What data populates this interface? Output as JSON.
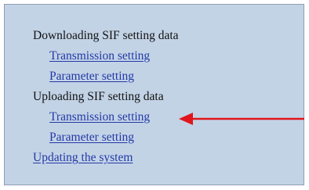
{
  "menu": {
    "download_heading": "Downloading SIF setting data",
    "download_items": [
      "Transmission setting",
      "Parameter setting"
    ],
    "upload_heading": "Uploading SIF setting data",
    "upload_items": [
      "Transmission setting",
      "Parameter setting"
    ],
    "update_link": "Updating the system"
  },
  "colors": {
    "panel_bg": "#c3d3e6",
    "link": "#2339a6",
    "arrow": "#e0161b"
  },
  "annotation": {
    "icon": "red-arrow-icon",
    "points_to": "upload-transmission-setting-link"
  }
}
